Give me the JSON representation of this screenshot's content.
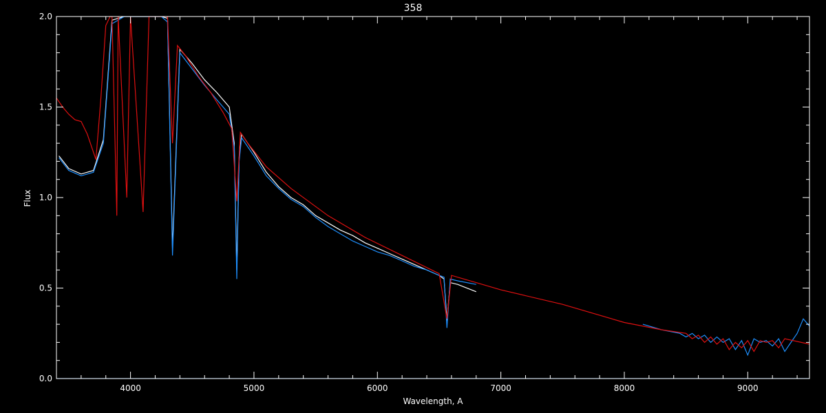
{
  "chart_data": {
    "type": "line",
    "title": "358",
    "xlabel": "Wavelength, A",
    "ylabel": "Flux",
    "xlim": [
      3400,
      9500
    ],
    "ylim": [
      0.0,
      2.0
    ],
    "xticks": [
      4000,
      5000,
      6000,
      7000,
      8000,
      9000
    ],
    "xtick_labels": [
      "4000",
      "5000",
      "6000",
      "7000",
      "8000",
      "9000"
    ],
    "yticks": [
      0.0,
      0.5,
      1.0,
      1.5,
      2.0
    ],
    "ytick_labels": [
      "0.0",
      "0.5",
      "1.0",
      "1.5",
      "2.0"
    ],
    "grid": false,
    "colors": {
      "background": "#000000",
      "axes": "#ffffff"
    },
    "series": [
      {
        "color": "#ffffff",
        "x": [
          3420,
          3500,
          3600,
          3700,
          3780,
          3850,
          3950,
          4050,
          4150,
          4250,
          4300,
          4340,
          4400,
          4500,
          4600,
          4700,
          4800,
          4840,
          4861,
          4880,
          4900,
          5000,
          5100,
          5200,
          5300,
          5400,
          5500,
          5600,
          5700,
          5800,
          5900,
          6000,
          6100,
          6200,
          6300,
          6400,
          6500,
          6540,
          6563,
          6590,
          6650,
          6800
        ],
        "y": [
          1.23,
          1.16,
          1.13,
          1.15,
          1.32,
          1.98,
          2.0,
          2.0,
          2.0,
          2.0,
          1.99,
          0.72,
          1.82,
          1.74,
          1.65,
          1.58,
          1.5,
          1.3,
          0.6,
          1.22,
          1.35,
          1.25,
          1.14,
          1.06,
          1.0,
          0.96,
          0.9,
          0.86,
          0.82,
          0.79,
          0.75,
          0.72,
          0.69,
          0.66,
          0.63,
          0.6,
          0.57,
          0.55,
          0.32,
          0.53,
          0.52,
          0.48
        ]
      },
      {
        "color": "#1e90ff",
        "x": [
          3420,
          3500,
          3600,
          3700,
          3780,
          3850,
          3950,
          4050,
          4150,
          4250,
          4300,
          4340,
          4400,
          4500,
          4600,
          4700,
          4800,
          4840,
          4861,
          4880,
          4900,
          5000,
          5100,
          5200,
          5300,
          5400,
          5500,
          5600,
          5700,
          5800,
          5900,
          6000,
          6100,
          6200,
          6300,
          6400,
          6500,
          6540,
          6563,
          6590,
          6650,
          6800,
          null,
          8150,
          8300,
          8450,
          8500,
          8550,
          8600,
          8650,
          8700,
          8750,
          8800,
          8850,
          8900,
          8950,
          9000,
          9050,
          9100,
          9150,
          9200,
          9250,
          9300,
          9350,
          9400,
          9450,
          9500
        ],
        "y": [
          1.22,
          1.15,
          1.12,
          1.14,
          1.3,
          1.96,
          2.0,
          2.0,
          2.0,
          2.0,
          1.97,
          0.68,
          1.8,
          1.71,
          1.62,
          1.54,
          1.46,
          1.28,
          0.55,
          1.2,
          1.33,
          1.23,
          1.12,
          1.05,
          0.99,
          0.95,
          0.89,
          0.84,
          0.8,
          0.76,
          0.73,
          0.7,
          0.68,
          0.65,
          0.62,
          0.6,
          0.57,
          0.56,
          0.28,
          0.55,
          0.54,
          0.52,
          null,
          0.3,
          0.27,
          0.25,
          0.23,
          0.25,
          0.22,
          0.24,
          0.2,
          0.23,
          0.2,
          0.22,
          0.16,
          0.21,
          0.13,
          0.22,
          0.2,
          0.21,
          0.18,
          0.22,
          0.15,
          0.2,
          0.25,
          0.33,
          0.29
        ]
      },
      {
        "color": "#e01010",
        "x": [
          3400,
          3450,
          3500,
          3550,
          3600,
          3650,
          3700,
          3720,
          3760,
          3800,
          3835,
          3850,
          3889,
          3900,
          3970,
          4000,
          4102,
          4150,
          4250,
          4300,
          4340,
          4380,
          4450,
          4550,
          4650,
          4750,
          4820,
          4861,
          4890,
          4950,
          5100,
          5300,
          5600,
          5900,
          6200,
          6500,
          6563,
          6600,
          6800,
          7000,
          7500,
          8000,
          8300,
          8500,
          8550,
          8600,
          8650,
          8700,
          8750,
          8800,
          8850,
          8900,
          8950,
          9000,
          9050,
          9100,
          9150,
          9200,
          9250,
          9300,
          9500
        ],
        "y": [
          1.55,
          1.5,
          1.46,
          1.43,
          1.42,
          1.35,
          1.25,
          1.21,
          1.55,
          1.95,
          2.0,
          2.0,
          0.9,
          2.0,
          1.0,
          2.0,
          0.92,
          2.0,
          2.0,
          2.0,
          1.3,
          1.84,
          1.78,
          1.67,
          1.58,
          1.47,
          1.38,
          0.98,
          1.36,
          1.3,
          1.17,
          1.05,
          0.9,
          0.78,
          0.68,
          0.58,
          0.33,
          0.57,
          0.53,
          0.49,
          0.41,
          0.31,
          0.27,
          0.25,
          0.22,
          0.24,
          0.2,
          0.23,
          0.19,
          0.22,
          0.16,
          0.2,
          0.17,
          0.21,
          0.15,
          0.21,
          0.2,
          0.21,
          0.17,
          0.22,
          0.19
        ]
      },
      {
        "color": "#1e90ff",
        "x": [
          3400,
          9500
        ],
        "y": [
          0.0,
          0.0
        ]
      }
    ]
  }
}
